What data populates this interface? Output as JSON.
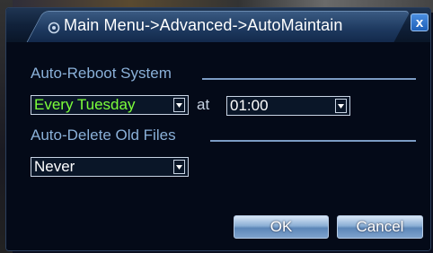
{
  "window": {
    "title": "Main Menu->Advanced->AutoMaintain",
    "close_label": "x"
  },
  "auto_reboot": {
    "section_label": "Auto-Reboot System",
    "schedule_value": "Every Tuesday",
    "at_label": "at",
    "time_value": "01:00"
  },
  "auto_delete": {
    "section_label": "Auto-Delete Old Files",
    "value": "Never"
  },
  "buttons": {
    "ok_label": "OK",
    "cancel_label": "Cancel"
  },
  "colors": {
    "section_label": "#8ab0d8",
    "highlighted_value": "#7cff3a",
    "value_text": "#ffffff",
    "button_text": "#ffffff"
  },
  "icons": {
    "title": "gear-icon",
    "close": "close-icon",
    "dropdown": "chevron-down-icon"
  }
}
